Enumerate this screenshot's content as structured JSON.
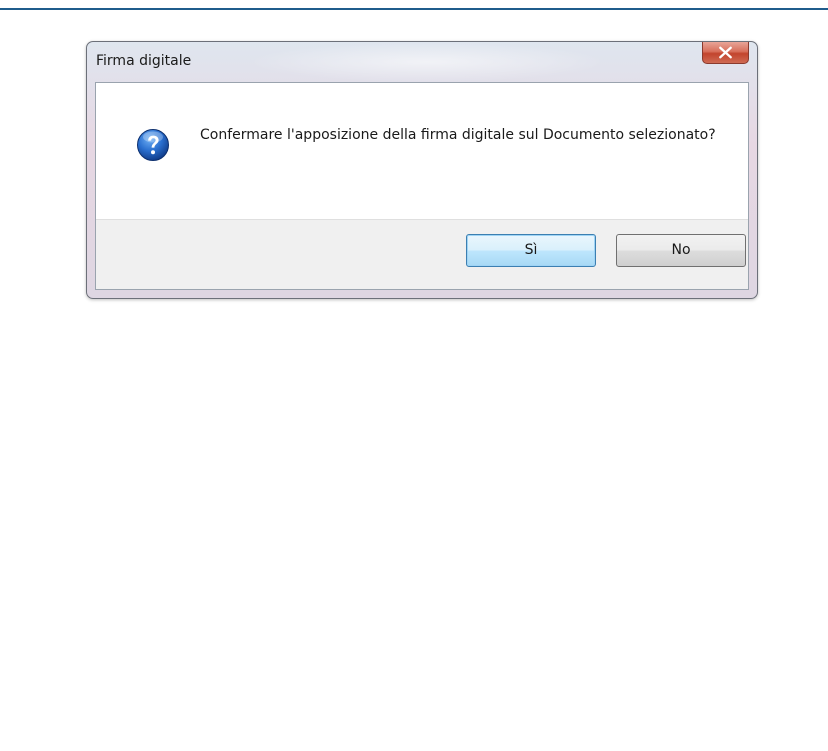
{
  "dialog": {
    "title": "Firma digitale",
    "message": "Confermare l'apposizione della firma digitale sul Documento selezionato?",
    "icon": "question-icon",
    "buttons": {
      "yes_label": "Sì",
      "no_label": "No"
    }
  },
  "colors": {
    "accent_rule": "#1f5c8c",
    "close_button": "#c2442d",
    "question_icon": "#1e5fb8"
  }
}
